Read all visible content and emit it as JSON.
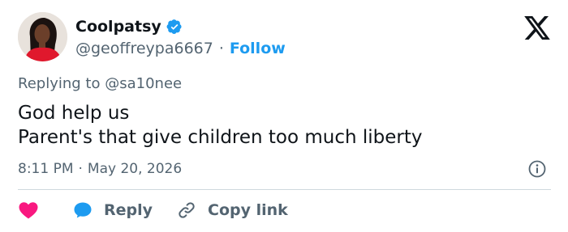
{
  "author": {
    "display_name": "Coolpatsy",
    "handle": "@geoffreypa6667",
    "separator": "·",
    "follow_label": "Follow",
    "verified": true
  },
  "reply_context": {
    "prefix": "Replying to",
    "target": "@sa10nee"
  },
  "tweet": {
    "lines": [
      "God help us",
      "Parent's that give children too much liberty"
    ]
  },
  "meta": {
    "time": "8:11 PM",
    "separator": "·",
    "date": "May 20, 2026"
  },
  "actions": {
    "reply_label": "Reply",
    "copy_link_label": "Copy link"
  },
  "icons": {
    "logo": "x-logo-icon",
    "verified": "verified-badge-icon",
    "info": "info-icon",
    "like": "heart-icon",
    "reply": "reply-bubble-icon",
    "copy": "link-icon"
  },
  "colors": {
    "text": "#0f1419",
    "secondary": "#536471",
    "accent": "#1d9bf0",
    "like": "#f91880",
    "divider": "#cfd9de"
  }
}
